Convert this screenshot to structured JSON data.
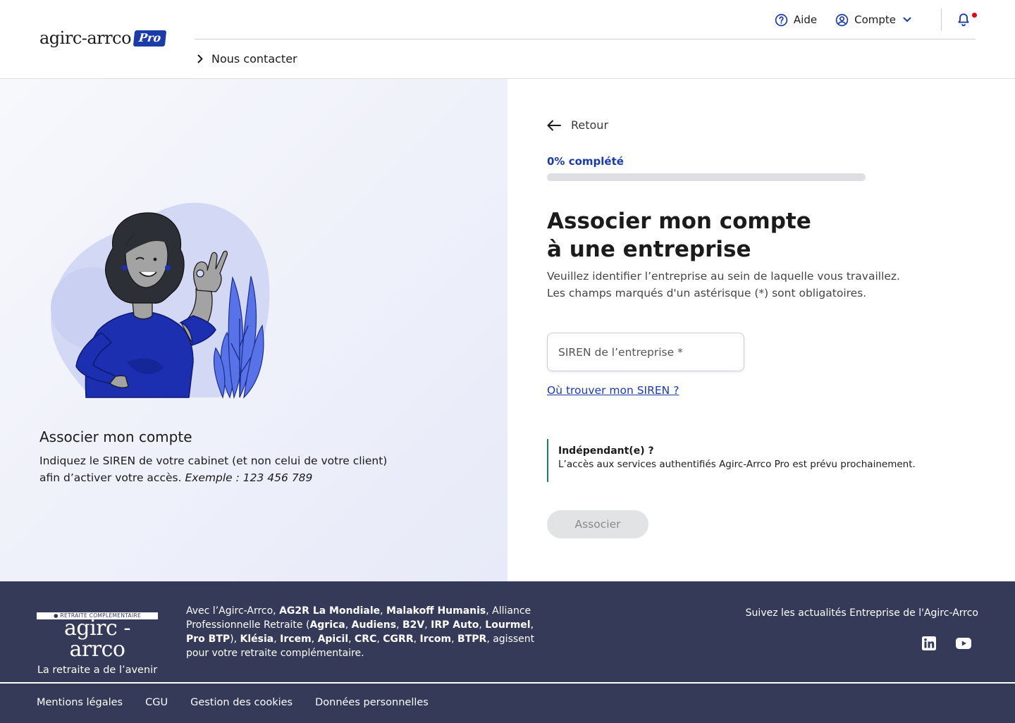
{
  "header": {
    "logo_text": "agirc-arrco",
    "logo_badge": "Pro",
    "help_label": "Aide",
    "account_label": "Compte",
    "contact_label": "Nous contacter"
  },
  "left": {
    "title": "Associer mon compte",
    "text": "Indiquez le SIREN de votre cabinet (et non celui de votre client) afin d’activer votre accès.",
    "example": "Exemple : 123 456 789"
  },
  "form": {
    "back_label": "Retour",
    "progress_label": "0% complété",
    "progress_value": 0,
    "title_line1": "Associer mon compte",
    "title_line2": "à une entreprise",
    "subtitle_line1": "Veuillez identifier l’entreprise au sein de laquelle vous travaillez.",
    "subtitle_line2": "Les champs marqués d'un astérisque (*) sont obligatoires.",
    "siren_placeholder": "SIREN de l’entreprise *",
    "siren_value": "",
    "help_link": "Où trouver mon SIREN ?",
    "info_title": "Indépendant(e) ?",
    "info_text": "L’accès aux services authentifiés Agirc-Arrco Pro est prévu prochainement.",
    "submit_label": "Associer"
  },
  "footer": {
    "logo_band": "● RETRAITE COMPLÉMENTAIRE",
    "logo_name": "agirc - arrco",
    "logo_tagline": "La retraite a de l’avenir",
    "text_parts": [
      {
        "t": "Avec l’Agirc-Arrco, ",
        "b": false
      },
      {
        "t": "AG2R La Mondiale",
        "b": true
      },
      {
        "t": ", ",
        "b": false
      },
      {
        "t": "Malakoff Humanis",
        "b": true
      },
      {
        "t": ", Alliance Professionnelle Retraite (",
        "b": false
      },
      {
        "t": "Agrica",
        "b": true
      },
      {
        "t": ", ",
        "b": false
      },
      {
        "t": "Audiens",
        "b": true
      },
      {
        "t": ", ",
        "b": false
      },
      {
        "t": "B2V",
        "b": true
      },
      {
        "t": ", ",
        "b": false
      },
      {
        "t": "IRP Auto",
        "b": true
      },
      {
        "t": ", ",
        "b": false
      },
      {
        "t": "Lourmel",
        "b": true
      },
      {
        "t": ", ",
        "b": false
      },
      {
        "t": "Pro BTP",
        "b": true
      },
      {
        "t": "), ",
        "b": false
      },
      {
        "t": "Klésia",
        "b": true
      },
      {
        "t": ", ",
        "b": false
      },
      {
        "t": "Ircem",
        "b": true
      },
      {
        "t": ", ",
        "b": false
      },
      {
        "t": "Apicil",
        "b": true
      },
      {
        "t": ", ",
        "b": false
      },
      {
        "t": "CRC",
        "b": true
      },
      {
        "t": ", ",
        "b": false
      },
      {
        "t": "CGRR",
        "b": true
      },
      {
        "t": ", ",
        "b": false
      },
      {
        "t": "Ircom",
        "b": true
      },
      {
        "t": ", ",
        "b": false
      },
      {
        "t": "BTPR",
        "b": true
      },
      {
        "t": ", agissent pour votre retraite complémentaire.",
        "b": false
      }
    ],
    "follow_label": "Suivez les actualités Entreprise de l'Agirc-Arrco",
    "social_icons": [
      "linkedin-icon",
      "youtube-icon"
    ],
    "links": [
      "Mentions légales",
      "CGU",
      "Gestion des cookies",
      "Données personnelles"
    ]
  },
  "colors": {
    "brand_blue": "#1b3ba8",
    "footer_bg": "#343a58",
    "notification_dot": "#e1000f",
    "info_border": "#1e7d6f",
    "disabled_button": "#e2e3e5"
  }
}
